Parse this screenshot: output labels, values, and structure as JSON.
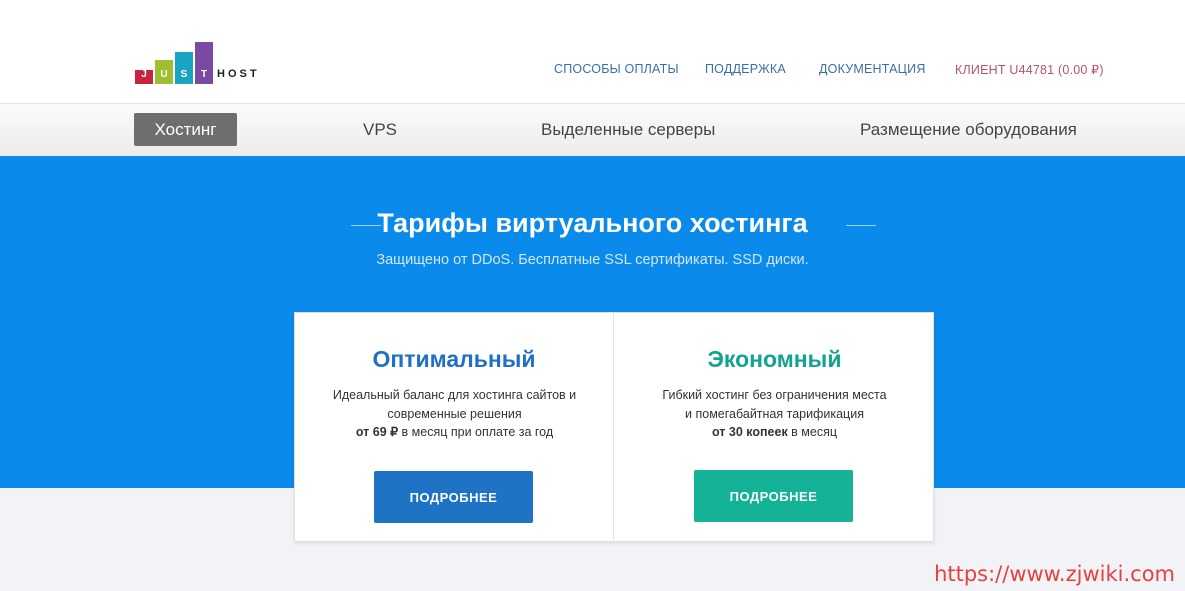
{
  "logo": {
    "letters": [
      "J",
      "U",
      "S",
      "T"
    ],
    "host": "HOST",
    "colors": [
      "#c8243f",
      "#9fbf2f",
      "#1aa3c2",
      "#7a4aa2"
    ]
  },
  "topnav": {
    "payment": "СПОСОБЫ ОПЛАТЫ",
    "support": "ПОДДЕРЖКА",
    "docs": "ДОКУМЕНТАЦИЯ",
    "client": "КЛИЕНТ U44781 (0.00 ₽)"
  },
  "menu": {
    "hosting": "Хостинг",
    "vps": "VPS",
    "dedicated": "Выделенные серверы",
    "colocation": "Размещение оборудования"
  },
  "hero": {
    "title": "Тарифы виртуального хостинга",
    "subtitle": "Защищено от DDoS. Бесплатные SSL сертификаты. SSD диски."
  },
  "plans": [
    {
      "name": "Оптимальный",
      "desc_line1": "Идеальный баланс для хостинга сайтов и",
      "desc_line2": "современные решения",
      "price_bold": "от 69 ₽",
      "price_rest": " в месяц при оплате за год",
      "button": "ПОДРОБНЕЕ",
      "color": "#2071c5"
    },
    {
      "name": "Экономный",
      "desc_line1": "Гибкий хостинг без ограничения места",
      "desc_line2": "и помегабайтная тарификация",
      "price_bold": "от 30 копеек",
      "price_rest": " в месяц",
      "button": "ПОДРОБНЕЕ",
      "color": "#12a48f"
    }
  ],
  "watermark": "https://www.zjwiki.com",
  "colors": {
    "hero_bg": "#0a8aea",
    "active_menu": "#6e6e6e"
  }
}
